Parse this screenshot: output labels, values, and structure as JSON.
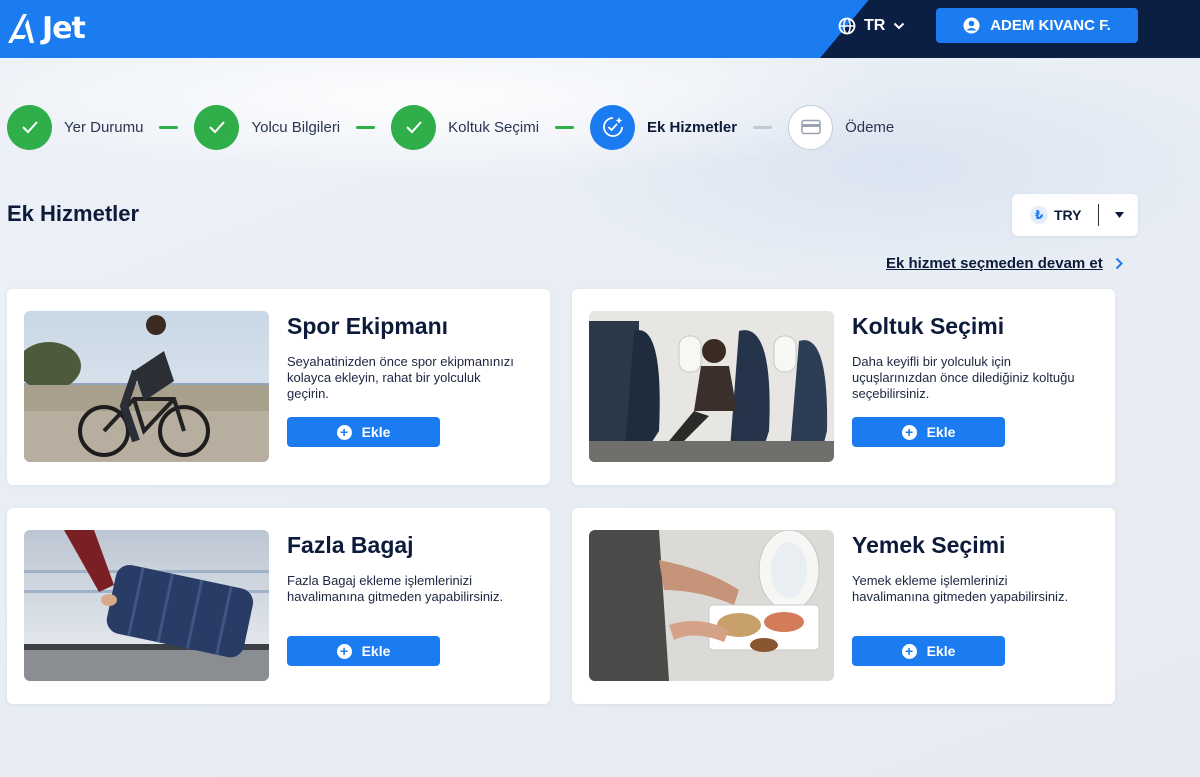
{
  "header": {
    "logo_text": "Jet",
    "language": "TR",
    "user_name": "ADEM KIVANC F."
  },
  "stepper": {
    "steps": [
      {
        "label": "Yer Durumu",
        "status": "completed"
      },
      {
        "label": "Yolcu Bilgileri",
        "status": "completed"
      },
      {
        "label": "Koltuk Seçimi",
        "status": "completed"
      },
      {
        "label": "Ek Hizmetler",
        "status": "active"
      },
      {
        "label": "Ödeme",
        "status": "pending"
      }
    ]
  },
  "page": {
    "title": "Ek Hizmetler",
    "currency_symbol": "₺",
    "currency": "TRY",
    "skip_link": "Ek hizmet seçmeden devam et"
  },
  "services": [
    {
      "title": "Spor Ekipmanı",
      "description": "Seyahatinizden önce spor ekipmanınızı kolayca ekleyin, rahat bir yolculuk geçirin.",
      "button": "Ekle",
      "image": "cyclist-photo"
    },
    {
      "title": "Koltuk Seçimi",
      "description": "Daha keyifli bir yolculuk için uçuşlarınızdan önce dilediğiniz koltuğu seçebilirsiniz.",
      "button": "Ekle",
      "image": "aircraft-cabin-photo"
    },
    {
      "title": "Fazla Bagaj",
      "description": "Fazla Bagaj ekleme işlemlerinizi havalimanına gitmeden yapabilirsiniz.",
      "button": "Ekle",
      "image": "suitcase-photo"
    },
    {
      "title": "Yemek Seçimi",
      "description": "Yemek ekleme işlemlerinizi havalimanına gitmeden yapabilirsiniz.",
      "button": "Ekle",
      "image": "inflight-meal-photo"
    }
  ],
  "colors": {
    "brand_blue": "#1a7cf0",
    "navy": "#0b1f45",
    "success_green": "#2fae4a"
  }
}
